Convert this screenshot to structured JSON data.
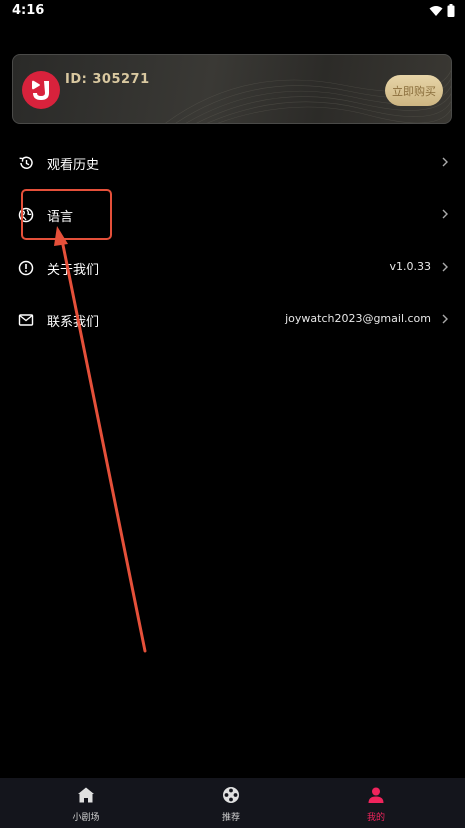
{
  "status_bar": {
    "time": "4:16"
  },
  "vip_card": {
    "user_id": "ID: 305271",
    "buy_label": "立即购买"
  },
  "menu": [
    {
      "label": "观看历史",
      "value": "",
      "icon": "history-icon"
    },
    {
      "label": "语言",
      "value": "",
      "icon": "globe-icon"
    },
    {
      "label": "关于我们",
      "value": "v1.0.33",
      "icon": "info-icon"
    },
    {
      "label": "联系我们",
      "value": "joywatch2023@gmail.com",
      "icon": "mail-icon"
    }
  ],
  "tab_bar": {
    "tabs": [
      {
        "label": "小剧场",
        "icon": "home-icon",
        "active": false
      },
      {
        "label": "推荐",
        "icon": "film-reel-icon",
        "active": false
      },
      {
        "label": "我的",
        "icon": "person-icon",
        "active": true
      }
    ]
  },
  "colors": {
    "background": "#000000",
    "tab_bar": "#14151c",
    "accent": "#f0245c",
    "gold": "#d9c8a0",
    "annotation": "#e5503a"
  }
}
